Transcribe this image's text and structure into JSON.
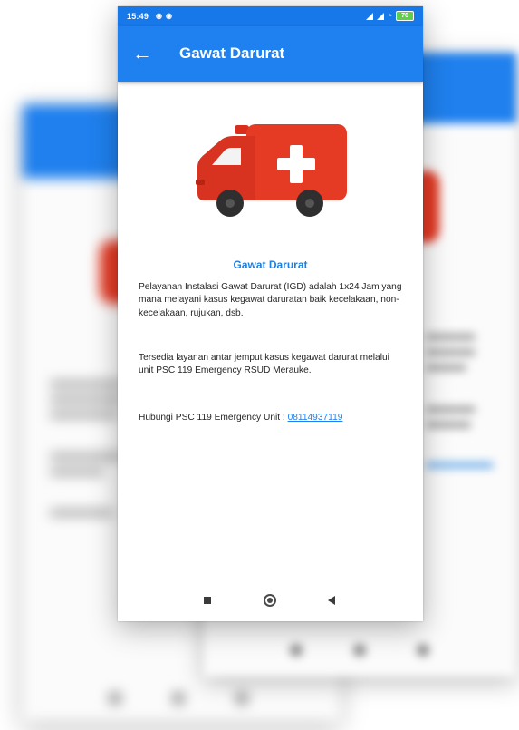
{
  "status_bar": {
    "time": "15:49",
    "left_icons": [
      "notification-icon",
      "notification-icon"
    ],
    "battery": "76",
    "right_icons": [
      "signal-icon",
      "signal-icon",
      "wifi-icon",
      "battery-icon"
    ]
  },
  "app_bar": {
    "title": "Gawat Darurat",
    "back_icon": "arrow-left-icon",
    "color": "#1f80f0"
  },
  "hero": {
    "icon": "ambulance-icon",
    "color": "#e53a24"
  },
  "content": {
    "heading": "Gawat Darurat",
    "paragraph_1": "Pelayanan Instalasi Gawat Darurat (IGD) adalah 1x24 Jam yang mana melayani kasus kegawat daruratan baik kecelakaan, non-kecelakaan, rujukan, dsb.",
    "paragraph_2": "Tersedia layanan antar jemput kasus kegawat darurat melalui unit PSC 119 Emergency RSUD Merauke.",
    "contact_label": "Hubungi PSC 119 Emergency Unit : ",
    "contact_number": "08114937119",
    "accent_color": "#1f7fe0"
  },
  "nav_bar": {
    "icons": [
      "recents-icon",
      "home-icon",
      "back-icon"
    ]
  }
}
